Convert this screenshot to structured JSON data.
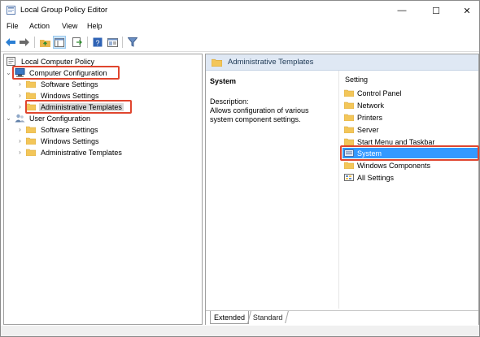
{
  "window": {
    "title": "Local Group Policy Editor",
    "controls": {
      "minimize": "—",
      "maximize": "☐",
      "close": "✕"
    }
  },
  "menubar": {
    "items": [
      "File",
      "Action",
      "View",
      "Help"
    ]
  },
  "toolbar": {
    "buttons": [
      "back-arrow-icon",
      "forward-arrow-icon",
      "up-folder-icon",
      "show-hide-tree-icon",
      "export-list-icon",
      "help-icon",
      "properties-pane-icon",
      "filter-icon"
    ]
  },
  "tree": {
    "root": "Local Computer Policy",
    "computer_config": {
      "label": "Computer Configuration",
      "children": [
        "Software Settings",
        "Windows Settings",
        "Administrative Templates"
      ]
    },
    "user_config": {
      "label": "User Configuration",
      "children": [
        "Software Settings",
        "Windows Settings",
        "Administrative Templates"
      ]
    }
  },
  "right": {
    "header": "Administrative Templates",
    "selected_title": "System",
    "description_label": "Description:",
    "description_text": "Allows configuration of various system component settings.",
    "column_header": "Setting",
    "items": [
      "Control Panel",
      "Network",
      "Printers",
      "Server",
      "Start Menu and Taskbar",
      "System",
      "Windows Components",
      "All Settings"
    ],
    "selected_item": "System"
  },
  "tabs": {
    "extended": "Extended",
    "standard": "Standard"
  },
  "colors": {
    "highlight_box": "#e0452e",
    "selection": "#3399ff",
    "header_bar": "#dfe8f4",
    "folder": "#f3c659"
  }
}
